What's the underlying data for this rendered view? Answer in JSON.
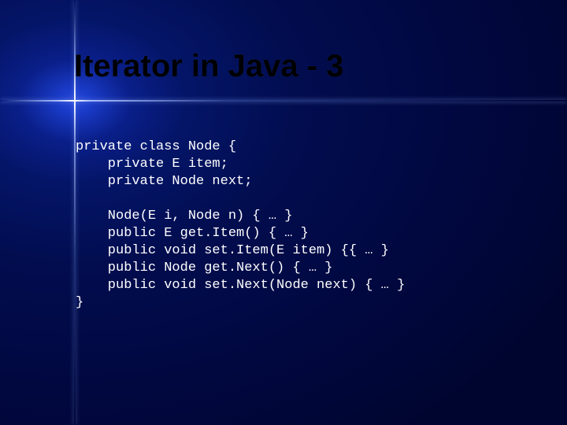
{
  "title": "Iterator in Java - 3",
  "code": {
    "l1": "private class Node {",
    "l2": "    private E item;",
    "l3": "    private Node next;",
    "l4": "",
    "l5": "    Node(E i, Node n) { … }",
    "l6": "    public E get.Item() { … }",
    "l7": "    public void set.Item(E item) {{ … }",
    "l8": "    public Node get.Next() { … }",
    "l9": "    public void set.Next(Node next) { … }",
    "l10": "}"
  }
}
